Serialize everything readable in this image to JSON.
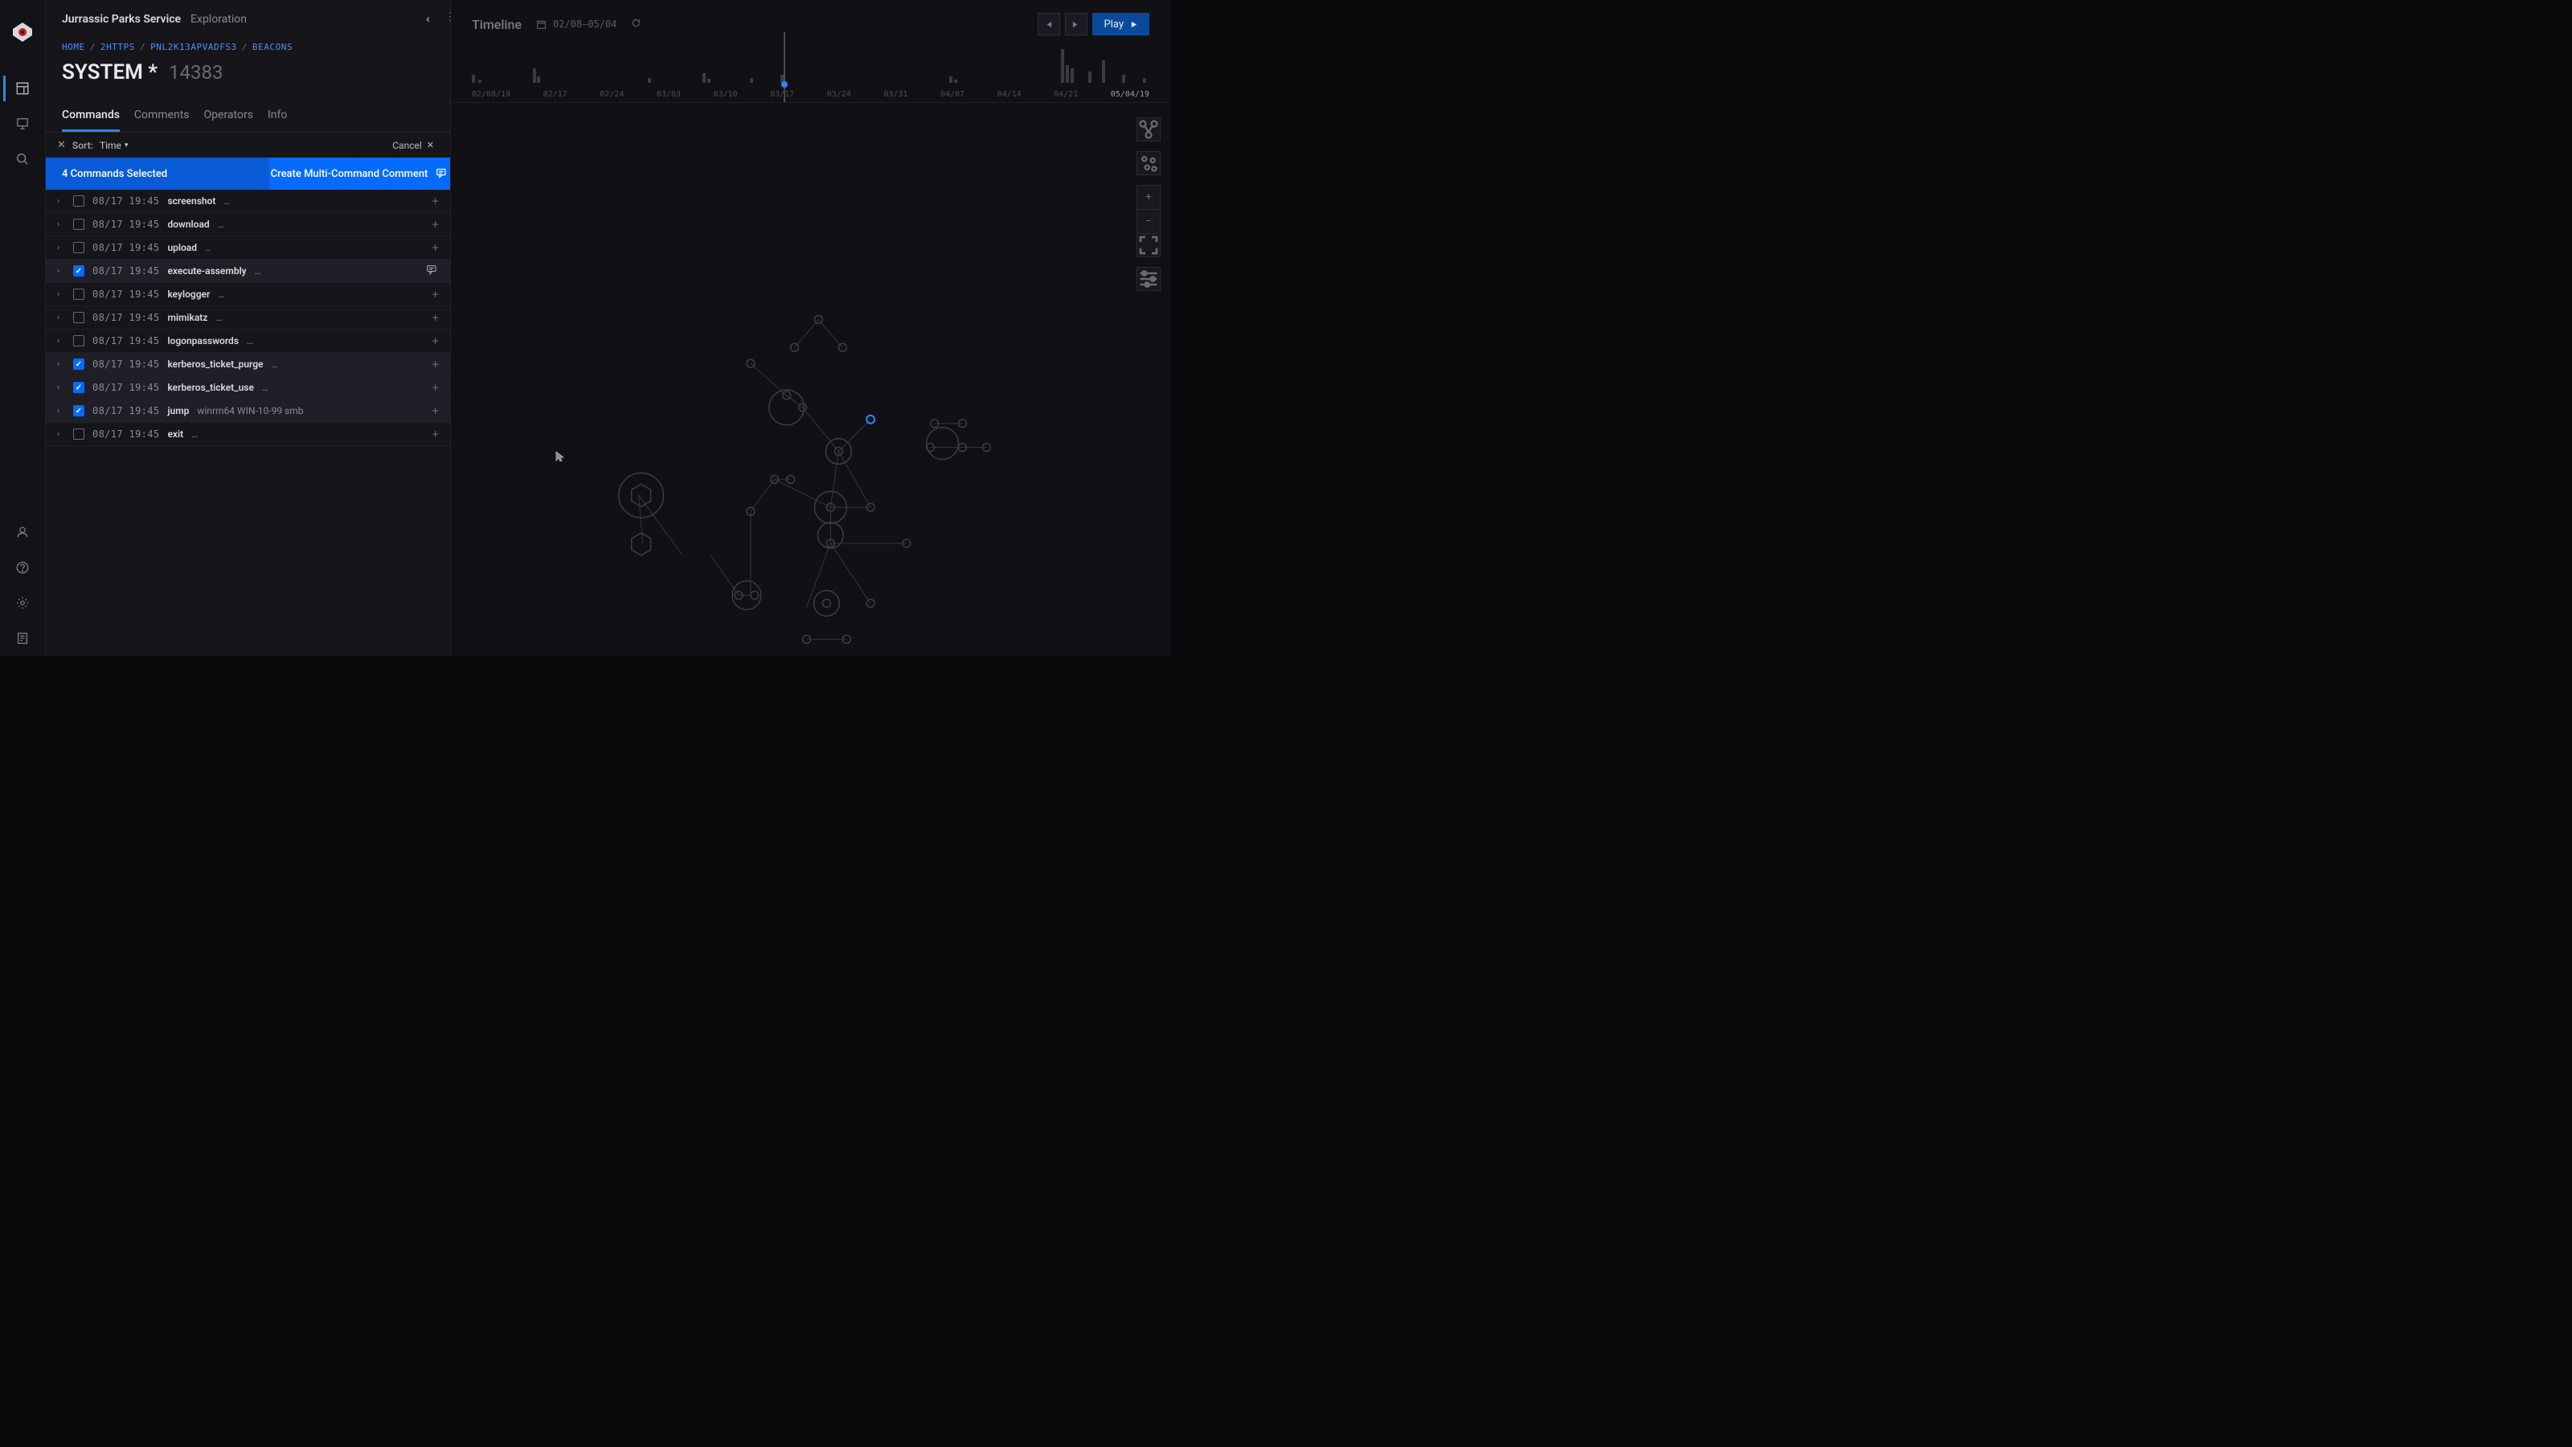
{
  "app": {
    "title": "Jurrassic Parks Service",
    "subtitle": "Exploration"
  },
  "breadcrumb": {
    "home": "Home",
    "b1": "2HTTPS",
    "b2": "PNL2K13APVADFS3",
    "b3": "Beacons"
  },
  "page": {
    "title": "SYSTEM *",
    "id": "14383"
  },
  "tabs": {
    "commands": "Commands",
    "comments": "Comments",
    "operators": "Operators",
    "info": "Info"
  },
  "sort": {
    "label": "Sort:",
    "value": "Time",
    "cancel": "Cancel"
  },
  "selection": {
    "count_text": "4 Commands Selected",
    "action": "Create Multi-Command Comment"
  },
  "commands": [
    {
      "ts": "08/17 19:45",
      "name": "screenshot",
      "args": "…",
      "checked": false
    },
    {
      "ts": "08/17 19:45",
      "name": "download",
      "args": "…",
      "checked": false
    },
    {
      "ts": "08/17 19:45",
      "name": "upload",
      "args": "…",
      "checked": false
    },
    {
      "ts": "08/17 19:45",
      "name": "execute-assembly",
      "args": "…",
      "checked": true,
      "has_comment_icon": true
    },
    {
      "ts": "08/17 19:45",
      "name": "keylogger",
      "args": "…",
      "checked": false
    },
    {
      "ts": "08/17 19:45",
      "name": "mimikatz",
      "args": "…",
      "checked": false
    },
    {
      "ts": "08/17 19:45",
      "name": "logonpasswords",
      "args": "…",
      "checked": false
    },
    {
      "ts": "08/17 19:45",
      "name": "kerberos_ticket_purge",
      "args": "…",
      "checked": true
    },
    {
      "ts": "08/17 19:45",
      "name": "kerberos_ticket_use",
      "args": "…",
      "checked": true
    },
    {
      "ts": "08/17 19:45",
      "name": "jump",
      "args": "winrm64 WIN-10-99 smb",
      "checked": true
    },
    {
      "ts": "08/17 19:45",
      "name": "exit",
      "args": "…",
      "checked": false
    }
  ],
  "timeline": {
    "title": "Timeline",
    "date_range": "02/08—05/04",
    "play": "Play",
    "ticks": [
      "02/08/19",
      "02/17",
      "02/24",
      "03/03",
      "03/10",
      "03/17",
      "03/24",
      "03/31",
      "04/07",
      "04/14",
      "04/21",
      "05/04/19"
    ],
    "marker_pct": 46.0,
    "bars": [
      {
        "x": 0,
        "h": 10
      },
      {
        "x": 1,
        "h": 4
      },
      {
        "x": 9,
        "h": 18
      },
      {
        "x": 9.6,
        "h": 8
      },
      {
        "x": 26,
        "h": 6
      },
      {
        "x": 34,
        "h": 12
      },
      {
        "x": 34.7,
        "h": 5
      },
      {
        "x": 41,
        "h": 6
      },
      {
        "x": 45.5,
        "h": 10
      },
      {
        "x": 70.5,
        "h": 8
      },
      {
        "x": 71.2,
        "h": 4
      },
      {
        "x": 87,
        "h": 42
      },
      {
        "x": 87.7,
        "h": 22
      },
      {
        "x": 88.4,
        "h": 18
      },
      {
        "x": 91,
        "h": 14
      },
      {
        "x": 93,
        "h": 28
      },
      {
        "x": 96,
        "h": 10
      },
      {
        "x": 99,
        "h": 6
      }
    ]
  },
  "graph_tools": {
    "layout": "layout",
    "random": "random",
    "zoom_in": "+",
    "zoom_out": "−",
    "fit": "fit",
    "settings": "settings"
  }
}
